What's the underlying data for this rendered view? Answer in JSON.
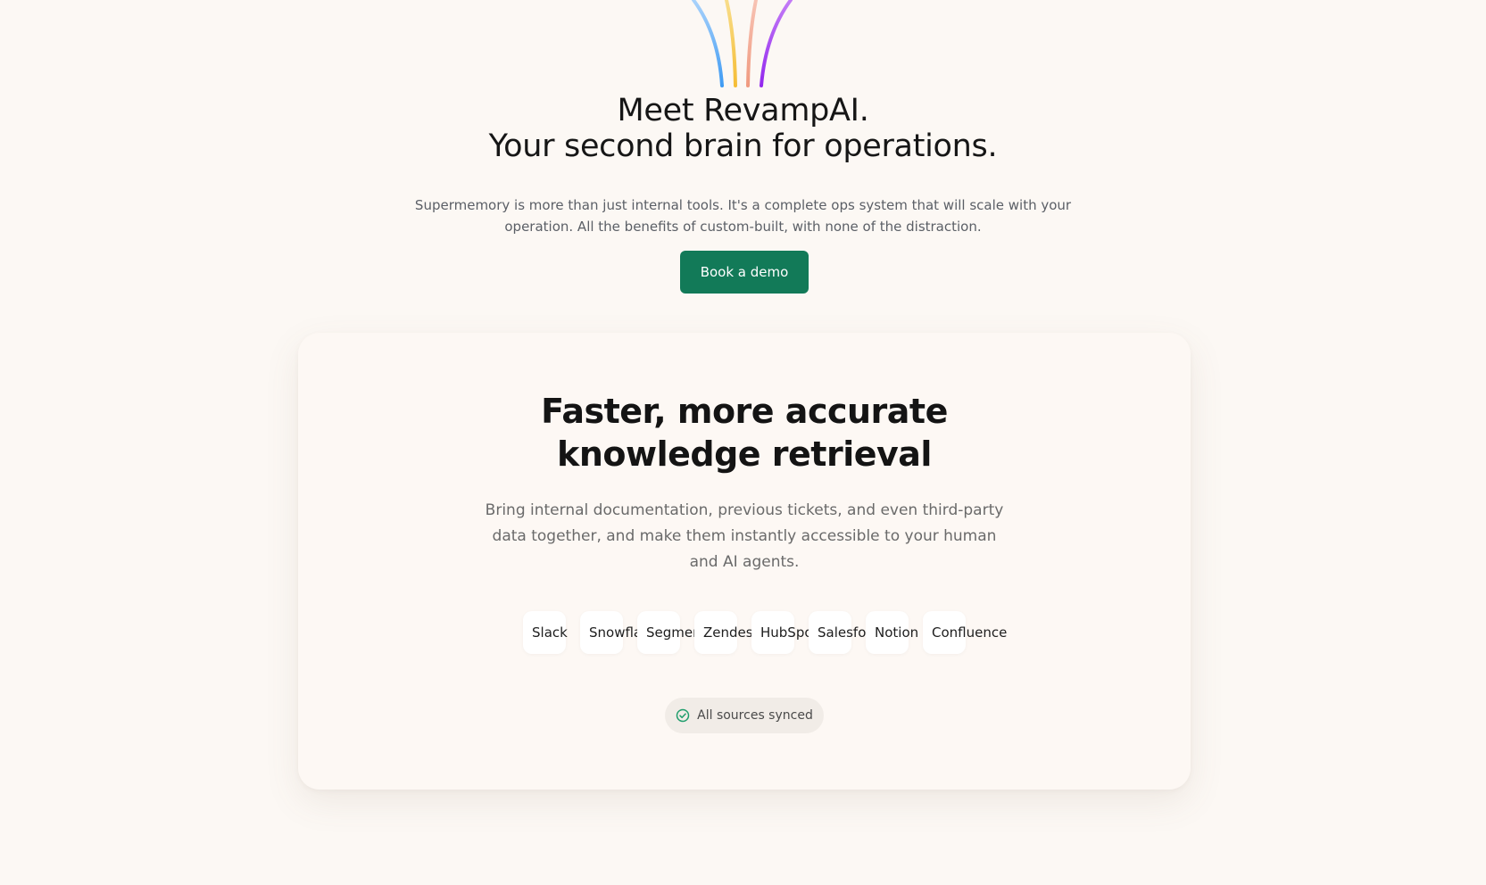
{
  "hero": {
    "title_line1": "Meet RevampAI.",
    "title_line2": "Your second brain for operations.",
    "subtitle": "Supermemory is more than just internal tools. It's a complete ops system that will scale with your operation. All the benefits of custom-built, with none of the distraction.",
    "cta_label": "Book a demo",
    "arc_colors": [
      "#4da3f5",
      "#f5c242",
      "#f29e86",
      "#9b2ff0"
    ]
  },
  "feature": {
    "title_line1": "Faster, more accurate",
    "title_line2": "knowledge retrieval",
    "description": "Bring internal documentation, previous tickets, and even third-party data together, and make them instantly accessible to your human and AI agents.",
    "sources": [
      {
        "label": "Slack"
      },
      {
        "label": "Snowflake"
      },
      {
        "label": "Segment"
      },
      {
        "label": "Zendesk"
      },
      {
        "label": "HubSpot"
      },
      {
        "label": "Salesforce"
      },
      {
        "label": "Notion"
      },
      {
        "label": "Confluence"
      }
    ],
    "sync_status": "All sources synced",
    "sync_icon": "check-circle-icon",
    "sync_color": "#1f9d6c"
  },
  "colors": {
    "background": "#fcf8f4",
    "accent": "#127a58"
  }
}
